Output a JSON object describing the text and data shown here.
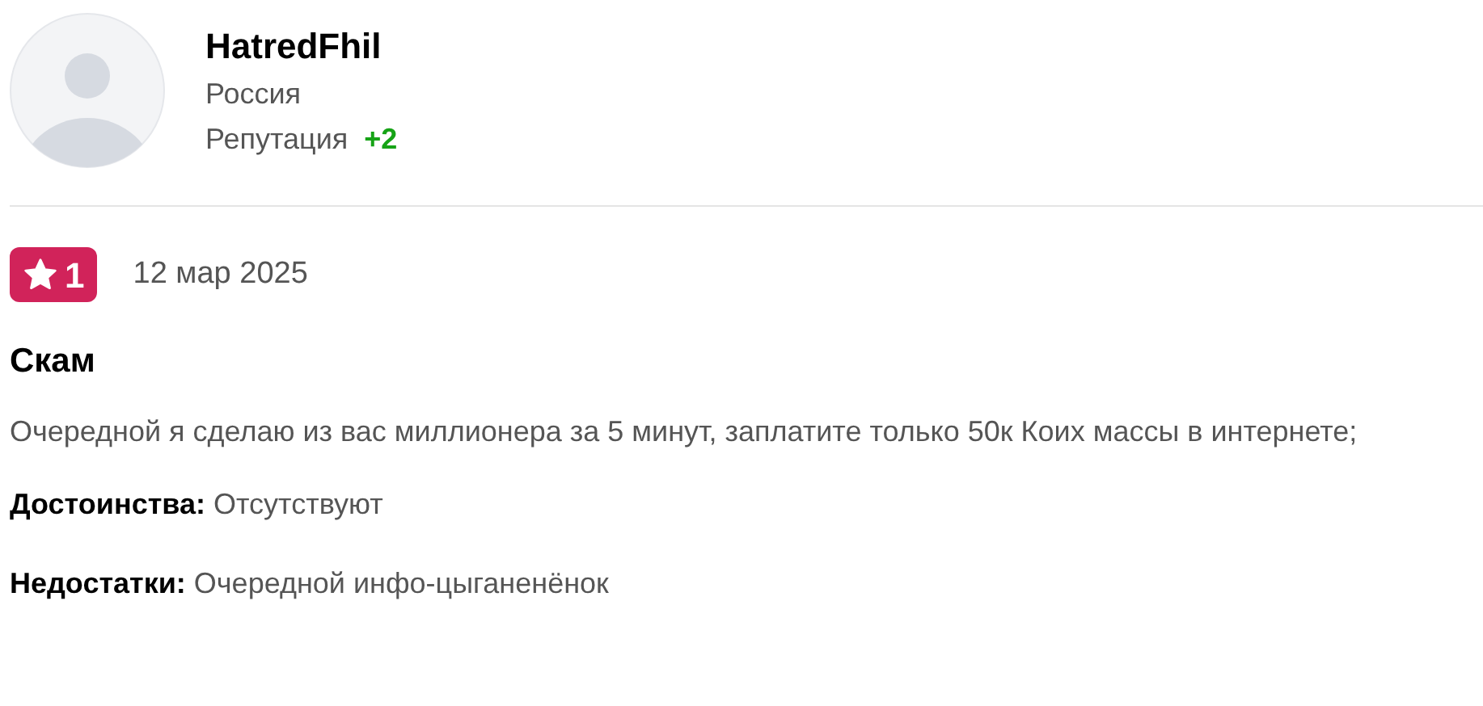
{
  "author": {
    "name": "HatredFhil",
    "country": "Россия",
    "reputation_label": "Репутация",
    "reputation": "+2"
  },
  "review": {
    "rating": "1",
    "date": "12 мар 2025",
    "title": "Скам",
    "text": "Очередной я сделаю из вас миллионера за 5 минут, заплатите только 50к Коих массы в интернете;",
    "pros": {
      "label": "Достоинства:",
      "value": "Отсутствуют"
    },
    "cons": {
      "label": "Недостатки:",
      "value": "Очередной инфо-цыганенёнок"
    }
  }
}
